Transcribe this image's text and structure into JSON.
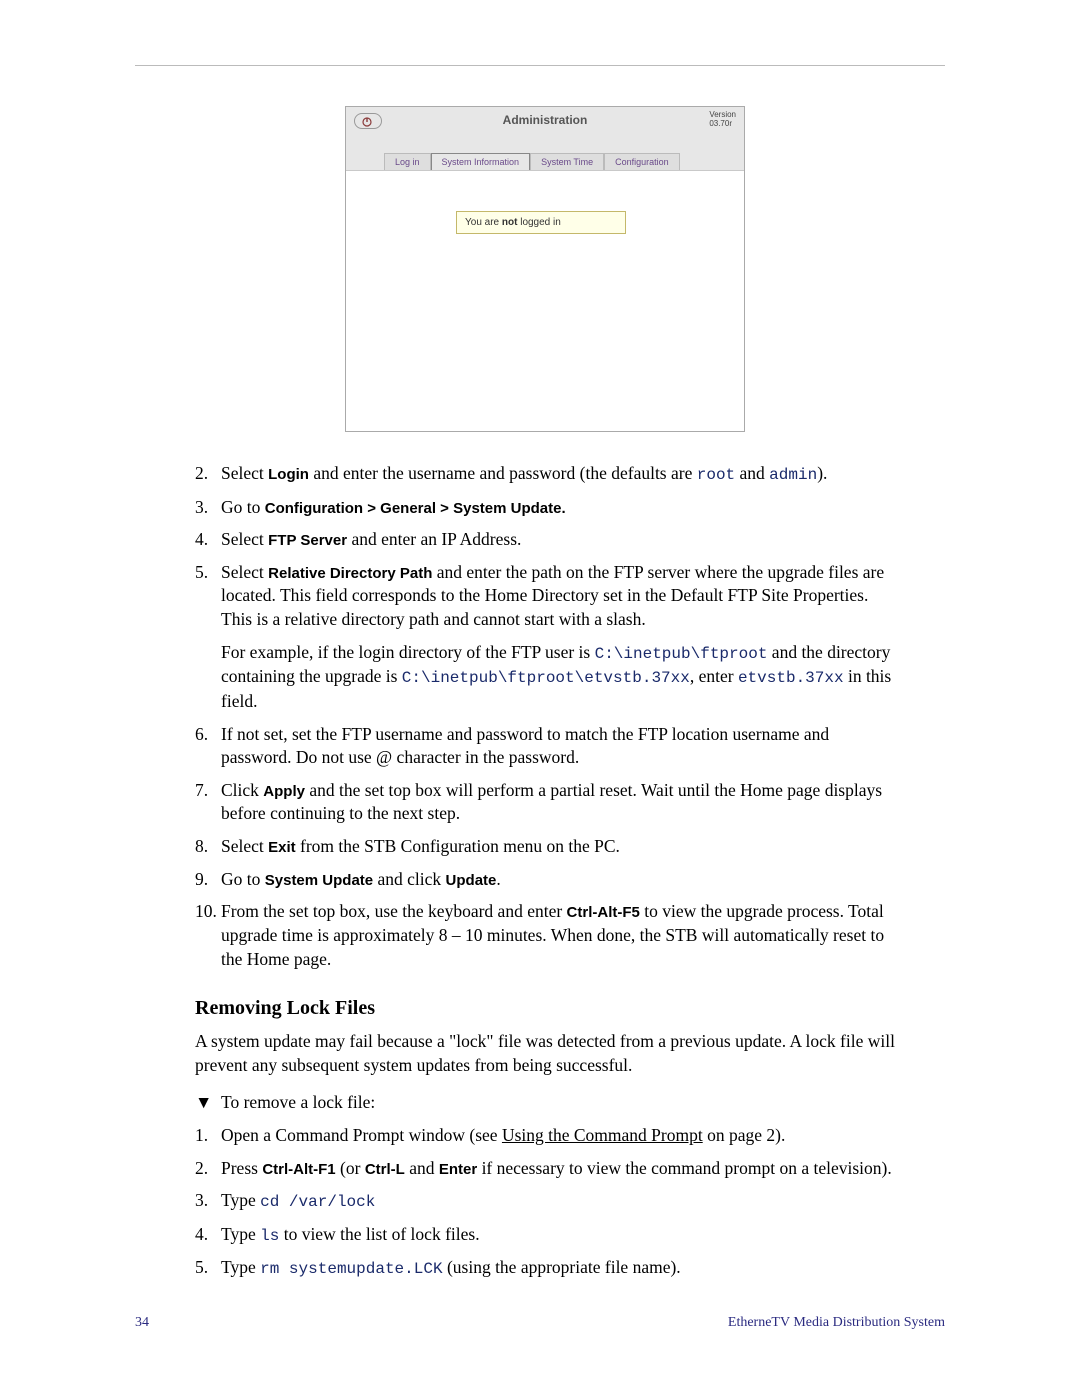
{
  "admin": {
    "title": "Administration",
    "version_label": "Version",
    "version_value": "03.70r",
    "tabs": [
      "Log in",
      "System Information",
      "System Time",
      "Configuration"
    ],
    "login_msg_pre": "You are ",
    "login_msg_bold": "not",
    "login_msg_post": " logged in"
  },
  "steps_a": [
    {
      "n": "2.",
      "html": "Select <span class='sans-bold'>Login</span> and enter the username and password (the defaults are <span class='mono'>root</span> and <span class='mono'>admin</span>)."
    },
    {
      "n": "3.",
      "html": "Go to <span class='sans-bold'>Configuration &gt; General &gt; System Update.</span>"
    },
    {
      "n": "4.",
      "html": "Select <span class='sans-bold'>FTP Server</span> and enter an IP Address."
    },
    {
      "n": "5.",
      "html": "Select <span class='sans-bold'>Relative Directory Path</span> and enter the path on the FTP server where the upgrade files are located. This field corresponds to the Home Directory set in the Default FTP Site Properties. This is a relative directory path and cannot start with a slash.",
      "html2": "For example, if the login directory of the FTP user is <span class='mono'>C:\\inetpub\\ftproot</span> and the directory containing the upgrade is <span class='mono'>C:\\inetpub\\ftproot\\etvstb.37xx</span>, enter <span class='mono'>etvstb.37xx</span> in this field."
    },
    {
      "n": "6.",
      "html": "If not set, set the FTP username and password to match the FTP location username and password. Do not use @ character in the password."
    },
    {
      "n": "7.",
      "html": "Click <span class='sans-bold'>Apply</span> and the set top box will perform a partial reset. Wait until the Home page displays before continuing to the next step."
    },
    {
      "n": "8.",
      "html": "Select <span class='sans-bold'>Exit</span> from the STB Configuration menu on the PC."
    },
    {
      "n": "9.",
      "html": "Go to <span class='sans-bold'>System Update</span> and click <span class='sans-bold'>Update</span>."
    },
    {
      "n": "10.",
      "html": "From the set top box, use the keyboard and enter <span class='sans-bold'>Ctrl-Alt-F5</span> to view the upgrade process. Total upgrade time is approximately 8 – 10 minutes. When done, the STB will automatically reset to the Home page."
    }
  ],
  "section2": {
    "heading": "Removing Lock Files",
    "intro": "A system update may fail because a \"lock\" file was detected from a previous update. A lock file will prevent any subsequent system updates from being successful.",
    "lead": "To remove a lock file:"
  },
  "steps_b": [
    {
      "n": "1.",
      "html": "Open a Command Prompt window (see <span class='link'>Using the Command Prompt</span> on page 2)."
    },
    {
      "n": "2.",
      "html": "Press <span class='sans-bold'>Ctrl-Alt-F1</span> (or <span class='sans-bold'>Ctrl-L</span> and <span class='sans-bold'>Enter</span> if necessary to view the command prompt on a television)."
    },
    {
      "n": "3.",
      "html": "Type <span class='mono'>cd /var/lock</span>"
    },
    {
      "n": "4.",
      "html": "Type <span class='mono'>ls</span> to view the list of lock files."
    },
    {
      "n": "5.",
      "html": "Type <span class='mono'>rm systemupdate.LCK</span> (using the appropriate file name)."
    }
  ],
  "footer": {
    "page": "34",
    "title": "EtherneTV Media Distribution System"
  }
}
